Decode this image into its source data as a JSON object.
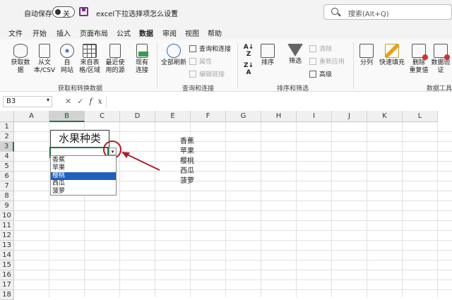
{
  "titlebar": {
    "autosave_label": "自动保存",
    "toggle_state": "关",
    "doc_title": "excel下拉选择项怎么设置",
    "doc_chevron": "⌄",
    "search_placeholder": "搜索(Alt+Q)"
  },
  "menu": {
    "tabs": [
      {
        "label": "文件"
      },
      {
        "label": "开始"
      },
      {
        "label": "插入"
      },
      {
        "label": "页面布局"
      },
      {
        "label": "公式"
      },
      {
        "label": "数据",
        "active": true
      },
      {
        "label": "审阅"
      },
      {
        "label": "视图"
      },
      {
        "label": "帮助"
      }
    ]
  },
  "ribbon": {
    "get_data": {
      "btn1": "获取数\n据",
      "btn2": "从文\n本/CSV",
      "btn3": "自\n网站",
      "btn4": "来自表\n格/区域",
      "btn5": "最近使\n用的源",
      "btn6": "现有\n连接",
      "group_label": "获取和转换数据"
    },
    "queries": {
      "refresh_all": "全部刷新",
      "queries_connections": "查询和连接",
      "properties": "属性",
      "edit_links": "编辑链接",
      "group_label": "查询和连接"
    },
    "sort_filter": {
      "sort": "排序",
      "filter": "筛选",
      "clear": "清除",
      "reapply": "重新应用",
      "advanced": "高级",
      "group_label": "排序和筛选"
    },
    "data_tools": {
      "split": "分列",
      "flash_fill": "快速填充",
      "remove_dup": "删除\n重复值",
      "validation": "数据验\n证",
      "group_label": "数据工具"
    }
  },
  "formula_bar": {
    "name_box": "B3",
    "fx": "fx"
  },
  "sheet": {
    "columns": [
      "A",
      "B",
      "C",
      "D",
      "E",
      "F",
      "G",
      "H",
      "I",
      "J",
      "K",
      "L"
    ],
    "rows": [
      "1",
      "2",
      "3",
      "4",
      "5",
      "6",
      "7",
      "8",
      "9",
      "10",
      "11",
      "12",
      "13",
      "14",
      "15",
      "16",
      "17",
      "18"
    ],
    "b2_header": "水果种类",
    "e_column": [
      "香蕉",
      "苹果",
      "樱桃",
      "西瓜",
      "菠萝"
    ],
    "dropdown_items": [
      "香蕉",
      "苹果",
      "樱桃",
      "西瓜",
      "菠萝"
    ],
    "dropdown_selected": 2,
    "dropdown_button": "▾"
  }
}
